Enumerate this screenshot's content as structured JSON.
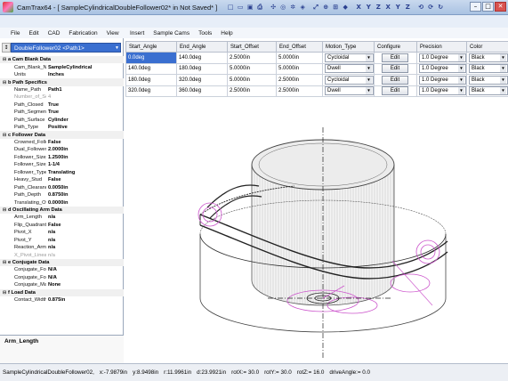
{
  "window": {
    "title": "CamTrax64 - [ SampleCylindricalDoubleFollower02*  in  Not Saved* ]",
    "controls": [
      "minimize",
      "restore",
      "close"
    ]
  },
  "quick_access": [
    "new",
    "open",
    "save",
    "print",
    "sep",
    "measure",
    "target",
    "cam",
    "scale",
    "sep",
    "fit",
    "zoom",
    "zoom-window",
    "cube",
    "sep",
    "X",
    "Y",
    "Z",
    "X",
    "Y",
    "Z",
    "sep",
    "rot-x",
    "rot-y",
    "rot-z"
  ],
  "menu": {
    "left": [
      "File",
      "Edit",
      "CAD",
      "Fabrication",
      "View"
    ],
    "right": [
      "Insert",
      "Sample Cams",
      "Tools",
      "Help"
    ]
  },
  "path_selector": {
    "value": "DoubleFollower02 <Path1>"
  },
  "properties": [
    {
      "type": "section",
      "label": "a Cam Blank Data"
    },
    {
      "name": "Cam_Blank_Name",
      "value": "SampleCylindrical"
    },
    {
      "name": "Units",
      "value": "Inches"
    },
    {
      "type": "section",
      "label": "b Path Specifics"
    },
    {
      "name": "Name_Path",
      "value": "Path1"
    },
    {
      "name": "Number_of_Segm",
      "value": "4",
      "disabled": true
    },
    {
      "name": "Path_Closed",
      "value": "True"
    },
    {
      "name": "Path_Segments_C",
      "value": "True"
    },
    {
      "name": "Path_Surface",
      "value": "Cylinder"
    },
    {
      "name": "Path_Type",
      "value": "Positive"
    },
    {
      "type": "section",
      "label": "c Follower Data"
    },
    {
      "name": "Crowned_Follow",
      "value": "False"
    },
    {
      "name": "Dual_Follower_S",
      "value": "2.0000in"
    },
    {
      "name": "Follower_Size_Di",
      "value": "1.2500in"
    },
    {
      "name": "Follower_Size_N",
      "value": "1-1/4"
    },
    {
      "name": "Follower_Type",
      "value": "Translating"
    },
    {
      "name": "Heavy_Stud",
      "value": "False"
    },
    {
      "name": "Path_Clearance",
      "value": "0.0050in"
    },
    {
      "name": "Path_Depth",
      "value": "0.8750in"
    },
    {
      "name": "Translating_Offse",
      "value": "0.0000in"
    },
    {
      "type": "section",
      "label": "d Oscillating Arm Data"
    },
    {
      "name": "Arm_Length",
      "value": "n/a"
    },
    {
      "name": "Flip_Quadrant",
      "value": "False"
    },
    {
      "name": "Pivot_X",
      "value": "n/a"
    },
    {
      "name": "Pivot_Y",
      "value": "n/a"
    },
    {
      "name": "Reaction_Arm_Le",
      "value": "n/a"
    },
    {
      "name": "X_Pivot_Linear_T",
      "value": "n/a",
      "disabled": true
    },
    {
      "type": "section",
      "label": "e Conjugate Data"
    },
    {
      "name": "Conjugate_Follow",
      "value": "N/A"
    },
    {
      "name": "Conjugate_Follow",
      "value": "N/A"
    },
    {
      "name": "Conjugate_Master",
      "value": "None"
    },
    {
      "type": "section",
      "label": "f Load Data"
    },
    {
      "name": "Contact_Width",
      "value": "0.875in"
    }
  ],
  "property_description": "Arm_Length",
  "grid": {
    "columns": [
      "Start_Angle",
      "End_Angle",
      "Start_Offset",
      "End_Offset",
      "Motion_Type",
      "Configure",
      "Precision",
      "Color"
    ],
    "rows": [
      {
        "start_angle": "0.0deg",
        "end_angle": "140.0deg",
        "start_offset": "2.5000in",
        "end_offset": "5.0000in",
        "motion_type": "Cycloidal",
        "configure": "Edit",
        "precision": "1.0 Degree",
        "color": "Black"
      },
      {
        "start_angle": "140.0deg",
        "end_angle": "180.0deg",
        "start_offset": "5.0000in",
        "end_offset": "5.0000in",
        "motion_type": "Dwell",
        "configure": "Edit",
        "precision": "1.0 Degree",
        "color": "Black"
      },
      {
        "start_angle": "180.0deg",
        "end_angle": "320.0deg",
        "start_offset": "5.0000in",
        "end_offset": "2.5000in",
        "motion_type": "Cycloidal",
        "configure": "Edit",
        "precision": "1.0 Degree",
        "color": "Black"
      },
      {
        "start_angle": "320.0deg",
        "end_angle": "360.0deg",
        "start_offset": "2.5000in",
        "end_offset": "2.5000in",
        "motion_type": "Dwell",
        "configure": "Edit",
        "precision": "1.0 Degree",
        "color": "Black"
      }
    ]
  },
  "status": {
    "file": "SampleCylindricalDoubleFollower02,",
    "x": "x:-7.9879in",
    "y": "y:8.9498in",
    "r": "r:11.9961in",
    "d": "d:23.9921in",
    "rotx": "rotX:= 30.0",
    "roty": "rotY:= 30.0",
    "rotz": "rotZ:= 16.0",
    "drive": "driveAngle:= 0.0"
  },
  "colors": {
    "selection": "#3a6fd0",
    "titlebar": "#b9cde8",
    "cam_lines": "#222222",
    "follower_magenta": "#cc55cc"
  }
}
